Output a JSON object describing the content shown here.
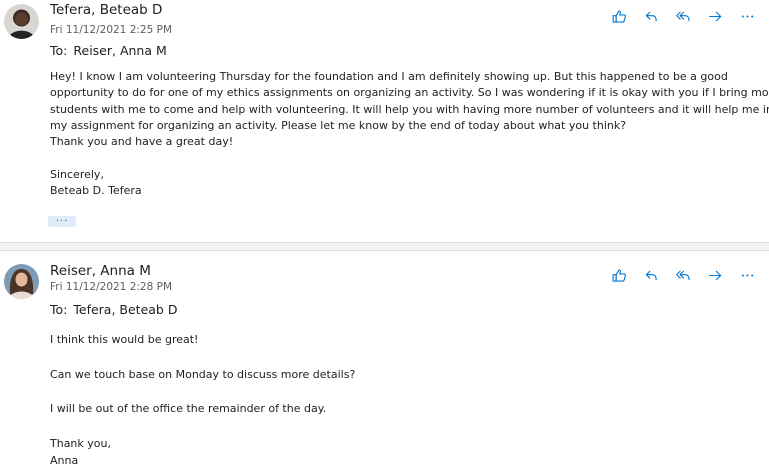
{
  "colors": {
    "accent": "#0078d4",
    "divider": "#f3f2f1",
    "text": "#201f1e",
    "muted": "#605e5c"
  },
  "messages": [
    {
      "sender": "Tefera, Beteab D",
      "date": "Fri 11/12/2021 2:25 PM",
      "to_label": "To:",
      "to": "Reiser, Anna M",
      "body": [
        "Hey! I know I am volunteering Thursday for the foundation and I am definitely showing up. But this happened to be a good",
        "opportunity to do for one of my ethics assignments on organizing an activity. So I was wondering if it is okay with you if I bring more",
        "students with me to come and help with volunteering. It will help you with having more number of volunteers and it will help me in",
        "my assignment for organizing an activity. Please let me know by the end of today about what you think?",
        "Thank you and have a great day!",
        "",
        "Sincerely,",
        "Beteab D. Tefera"
      ],
      "more_label": "···",
      "icons": [
        "like-icon",
        "reply-icon",
        "reply-all-icon",
        "forward-icon",
        "more-actions-icon"
      ]
    },
    {
      "sender": "Reiser, Anna M",
      "date": "Fri 11/12/2021 2:28 PM",
      "to_label": "To:",
      "to": "Tefera, Beteab D",
      "body": [
        "I think this would be great!",
        "",
        "Can we touch base on Monday to discuss more details?",
        "",
        "I will be out of the office the remainder of the day.",
        "",
        "Thank you,",
        "Anna"
      ],
      "icons": [
        "like-icon",
        "reply-icon",
        "reply-all-icon",
        "forward-icon",
        "more-actions-icon"
      ]
    }
  ]
}
